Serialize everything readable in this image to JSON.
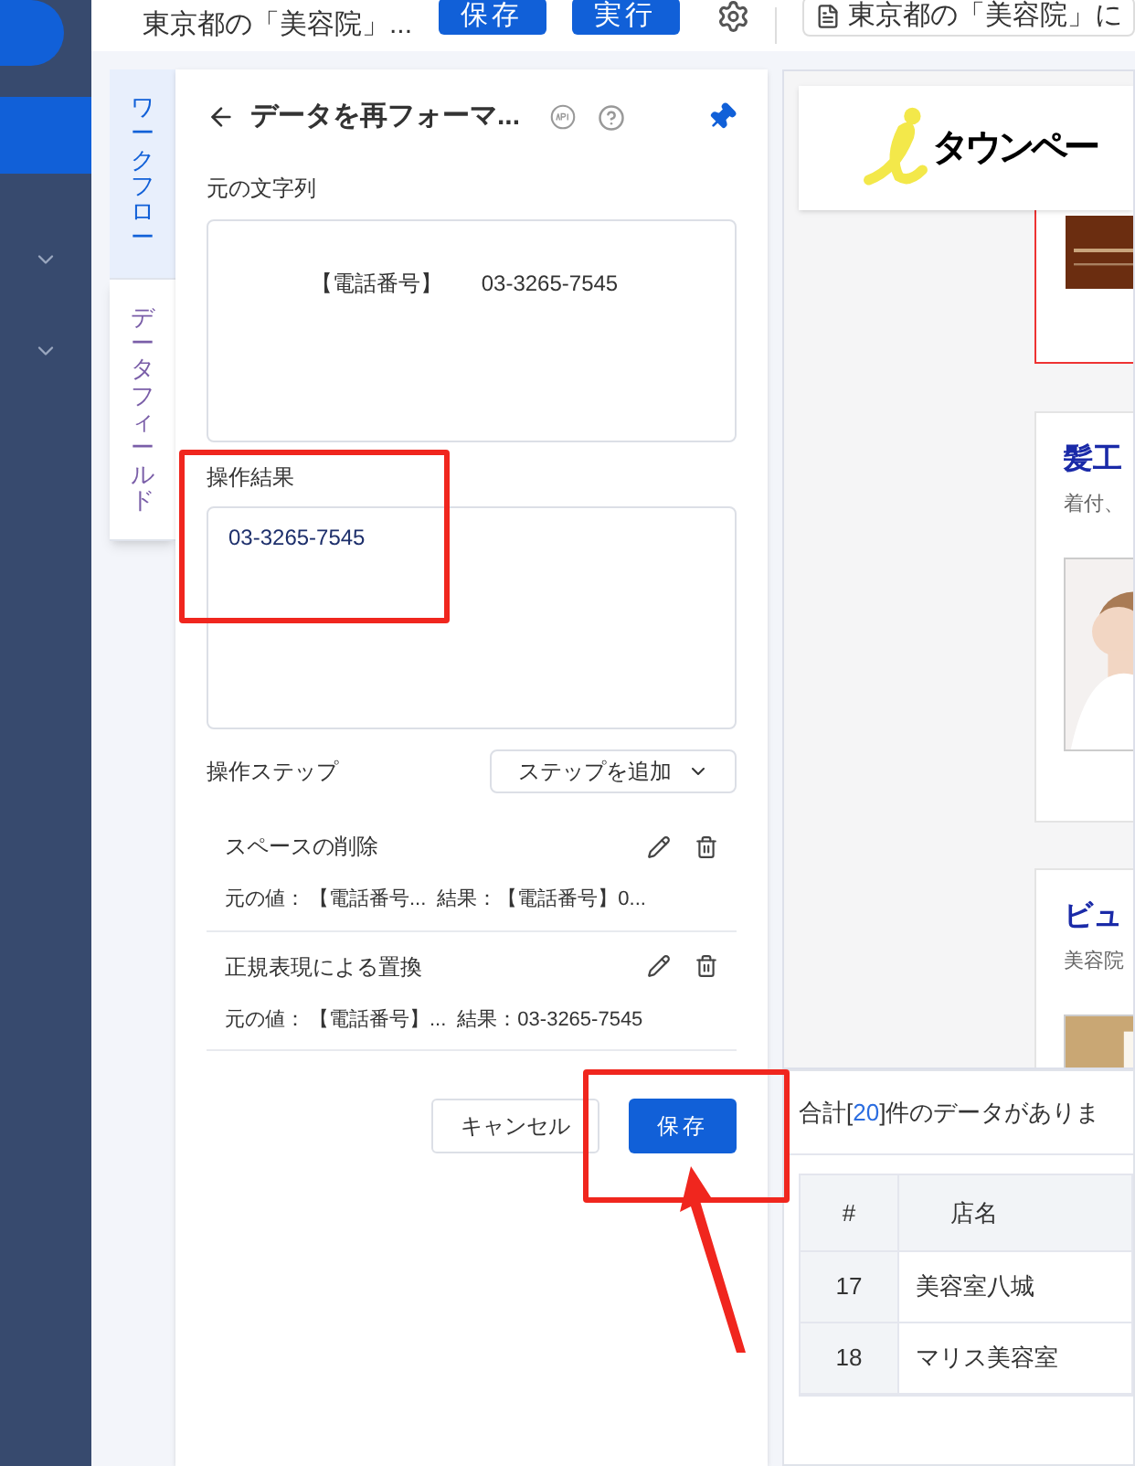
{
  "top_bar": {
    "title": "東京都の「美容院」...",
    "buttons": [
      {
        "label": "保存",
        "kind": "primary"
      },
      {
        "label": "実行",
        "kind": "primary"
      }
    ],
    "page_tab": "東京都の「美容院」に"
  },
  "side_tabs": [
    {
      "label": "ワークフロー",
      "selected": true
    },
    {
      "label": "データフィールド",
      "selected": false
    }
  ],
  "panel": {
    "title": "データを再フォーマ...",
    "source_label": "元の文字列",
    "source_value": "【電話番号】\t03-3265-7545",
    "result_label": "操作結果",
    "result_value": "03-3265-7545",
    "steps_label": "操作ステップ",
    "add_step": "ステップを追加",
    "steps": [
      {
        "name": "スペースの削除",
        "original_label": "元の値：",
        "original": "【電話番号...",
        "result_label": "結果：",
        "result": "【電話番号】0..."
      },
      {
        "name": "正規表現による置換",
        "original_label": "元の値：",
        "original": "【電話番号】...",
        "result_label": "結果：",
        "result": "03-3265-7545"
      }
    ],
    "cancel": "キャンセル",
    "save": "保存"
  },
  "preview": {
    "logo": "タウンペー",
    "cards": [
      {
        "title": "髪工",
        "subtitle": "着付、",
        "highlighted": false
      },
      {
        "title": "ビュ",
        "subtitle": "美容院",
        "highlighted": false
      }
    ]
  },
  "data_table": {
    "summary_prefix": "合計[",
    "count": "20",
    "summary_suffix": "]件のデータがありま",
    "columns": [
      "#",
      "店名"
    ],
    "rows": [
      {
        "index": "17",
        "name": "美容室八城"
      },
      {
        "index": "18",
        "name": "マリス美容室"
      }
    ]
  }
}
